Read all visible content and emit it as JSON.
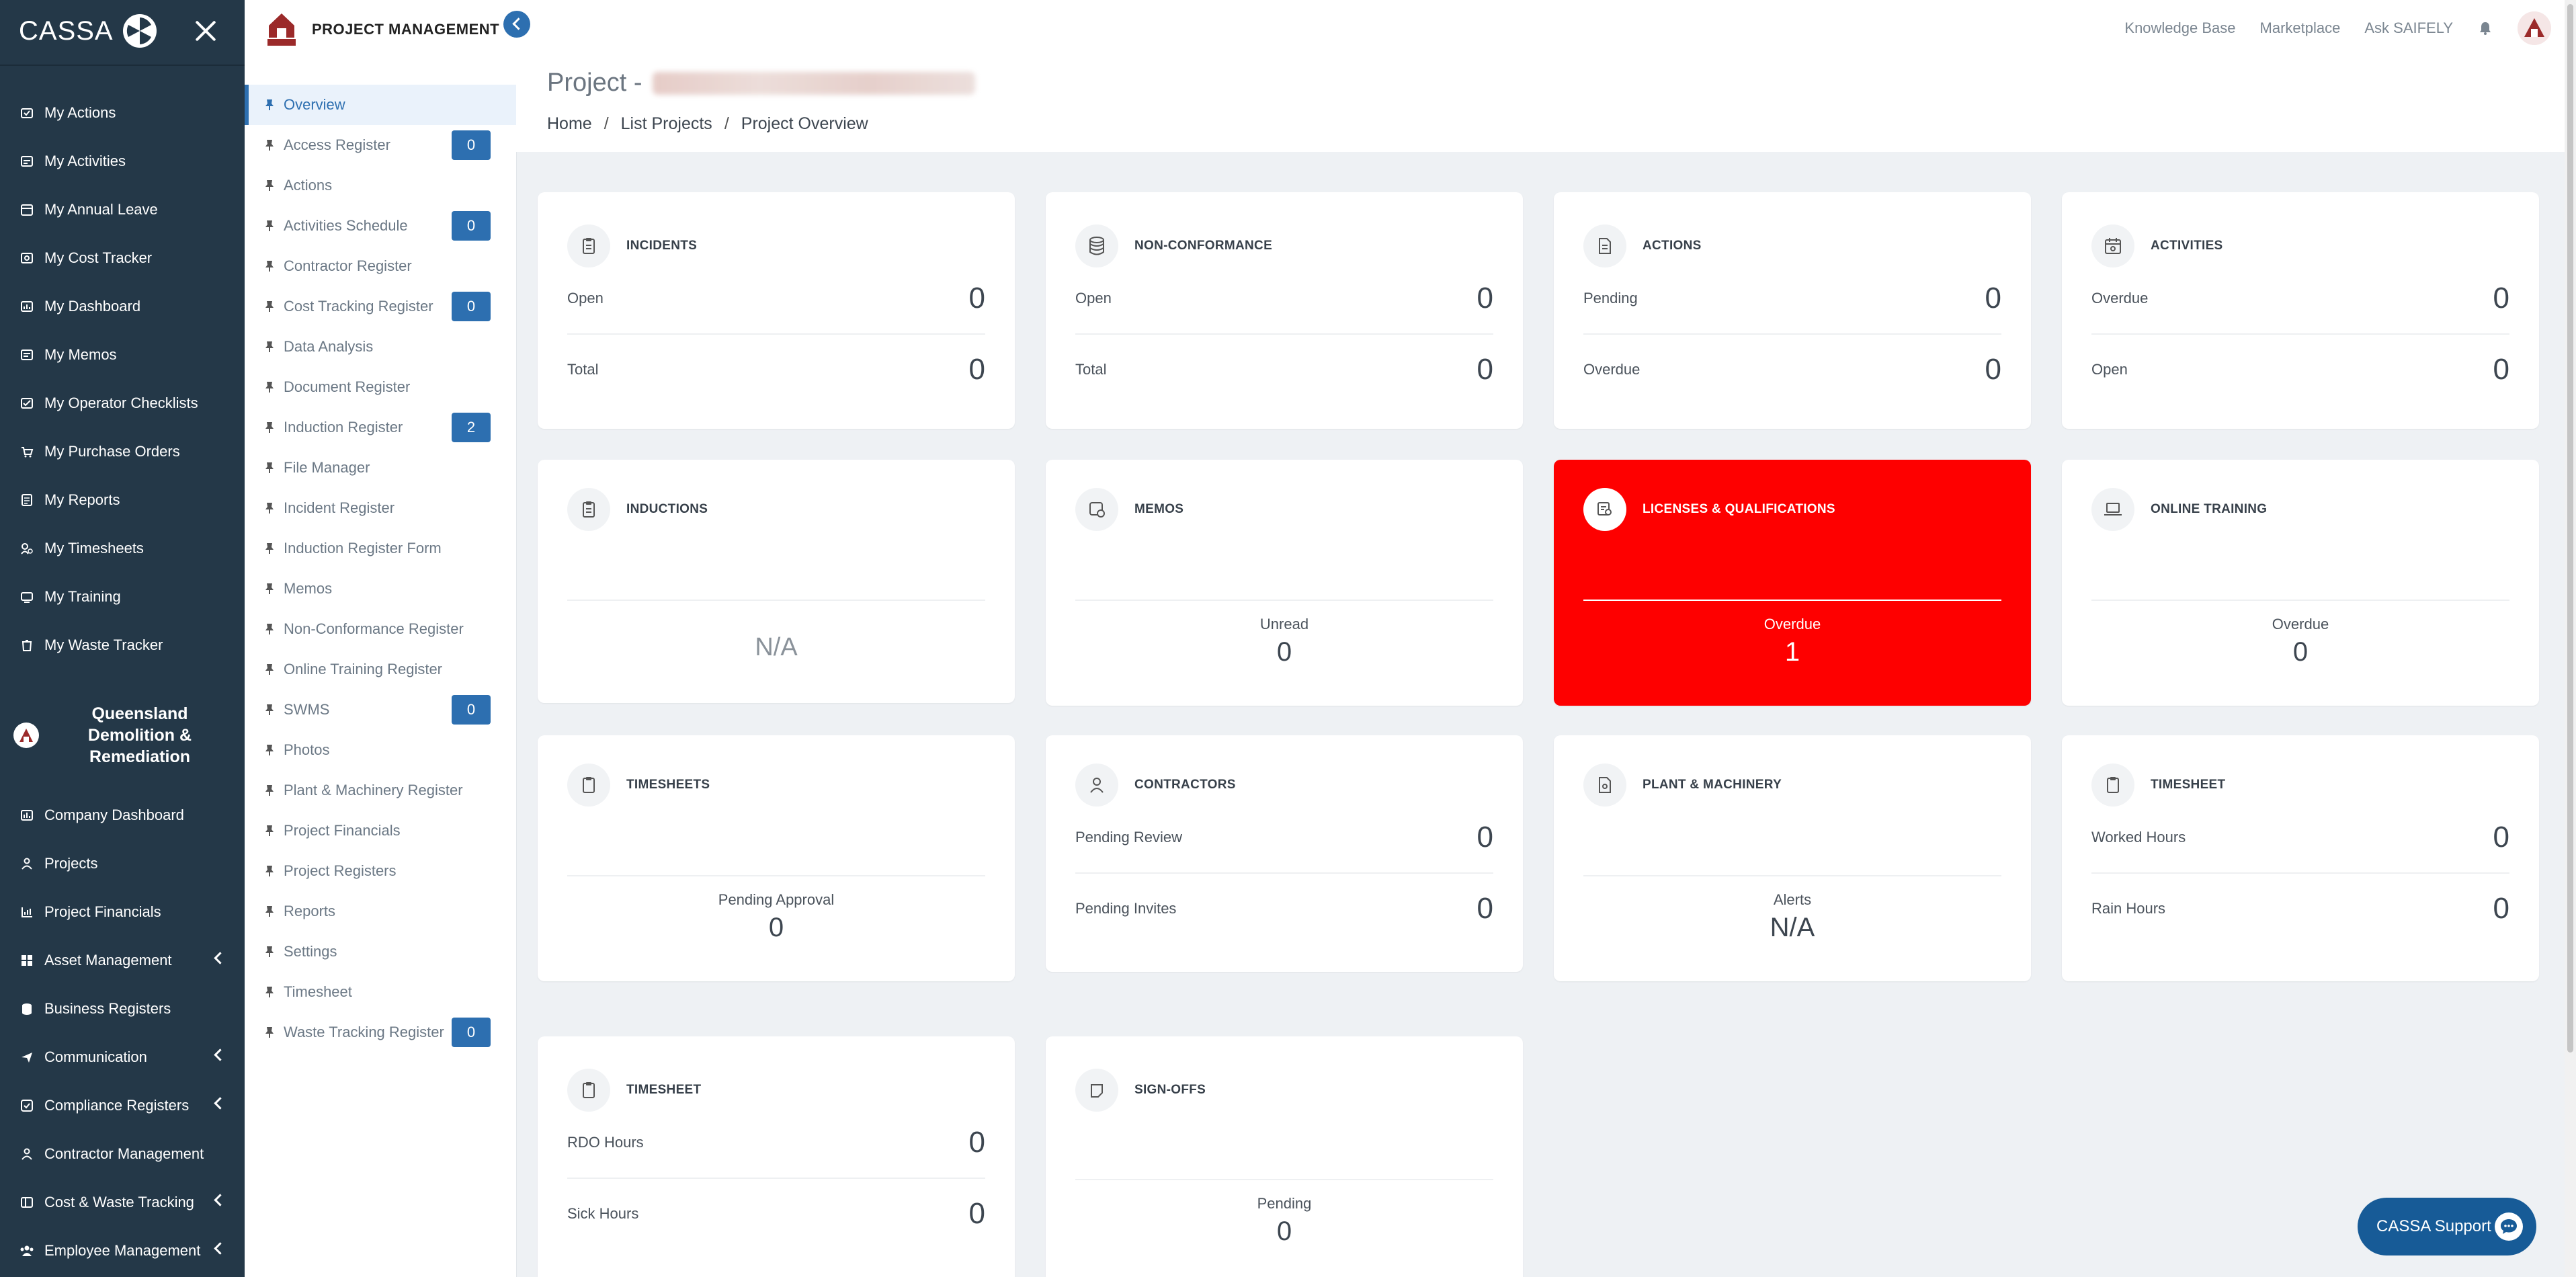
{
  "app": {
    "brand": "CASSA",
    "project_section_title": "PROJECT MANAGEMENT"
  },
  "sidebar": {
    "items": [
      {
        "label": "My Actions",
        "icon": "actions-icon"
      },
      {
        "label": "My Activities",
        "icon": "activities-icon"
      },
      {
        "label": "My Annual Leave",
        "icon": "leave-icon"
      },
      {
        "label": "My Cost Tracker",
        "icon": "cost-icon"
      },
      {
        "label": "My Dashboard",
        "icon": "dashboard-icon"
      },
      {
        "label": "My Memos",
        "icon": "memos-icon"
      },
      {
        "label": "My Operator Checklists",
        "icon": "checklist-icon"
      },
      {
        "label": "My Purchase Orders",
        "icon": "cart-icon"
      },
      {
        "label": "My Reports",
        "icon": "reports-icon"
      },
      {
        "label": "My Timesheets",
        "icon": "timesheets-icon"
      },
      {
        "label": "My Training",
        "icon": "training-icon"
      },
      {
        "label": "My Waste Tracker",
        "icon": "waste-icon"
      }
    ],
    "org_name": "Queensland Demolition & Remediation",
    "company_items": [
      {
        "label": "Company Dashboard",
        "icon": "company-dashboard-icon",
        "has_submenu": false
      },
      {
        "label": "Projects",
        "icon": "projects-icon",
        "has_submenu": false
      },
      {
        "label": "Project Financials",
        "icon": "financials-icon",
        "has_submenu": false
      },
      {
        "label": "Asset Management",
        "icon": "asset-icon",
        "has_submenu": true
      },
      {
        "label": "Business Registers",
        "icon": "registers-icon",
        "has_submenu": false
      },
      {
        "label": "Communication",
        "icon": "communication-icon",
        "has_submenu": true
      },
      {
        "label": "Compliance Registers",
        "icon": "compliance-icon",
        "has_submenu": true
      },
      {
        "label": "Contractor Management",
        "icon": "contractor-icon",
        "has_submenu": false
      },
      {
        "label": "Cost & Waste Tracking",
        "icon": "cost-waste-icon",
        "has_submenu": true
      },
      {
        "label": "Employee Management",
        "icon": "employee-icon",
        "has_submenu": true
      }
    ]
  },
  "project_nav": {
    "items": [
      {
        "label": "Overview",
        "active": true,
        "badge": null
      },
      {
        "label": "Access Register",
        "badge": "0"
      },
      {
        "label": "Actions",
        "badge": null
      },
      {
        "label": "Activities Schedule",
        "badge": "0"
      },
      {
        "label": "Contractor Register",
        "badge": null
      },
      {
        "label": "Cost Tracking Register",
        "badge": "0"
      },
      {
        "label": "Data Analysis",
        "badge": null
      },
      {
        "label": "Document Register",
        "badge": null
      },
      {
        "label": "Induction Register",
        "badge": "2"
      },
      {
        "label": "File Manager",
        "badge": null
      },
      {
        "label": "Incident Register",
        "badge": null
      },
      {
        "label": "Induction Register Form",
        "badge": null
      },
      {
        "label": "Memos",
        "badge": null
      },
      {
        "label": "Non-Conformance Register",
        "badge": null
      },
      {
        "label": "Online Training Register",
        "badge": null
      },
      {
        "label": "SWMS",
        "badge": "0"
      },
      {
        "label": "Photos",
        "badge": null
      },
      {
        "label": "Plant & Machinery Register",
        "badge": null
      },
      {
        "label": "Project Financials",
        "badge": null
      },
      {
        "label": "Project Registers",
        "badge": null
      },
      {
        "label": "Reports",
        "badge": null
      },
      {
        "label": "Settings",
        "badge": null
      },
      {
        "label": "Timesheet",
        "badge": null
      },
      {
        "label": "Waste Tracking Register",
        "badge": "0"
      }
    ]
  },
  "header": {
    "links": [
      "Knowledge Base",
      "Marketplace",
      "Ask SAIFELY"
    ]
  },
  "page": {
    "title_prefix": "Project -",
    "breadcrumb": [
      "Home",
      "List Projects",
      "Project Overview"
    ],
    "breadcrumb_sep": "/"
  },
  "cards": [
    {
      "id": "incidents",
      "title": "INCIDENTS",
      "icon": "clipboard-icon",
      "rows": [
        {
          "label": "Open",
          "value": "0"
        },
        {
          "label": "Total",
          "value": "0"
        }
      ]
    },
    {
      "id": "non-conformance",
      "title": "NON-CONFORMANCE",
      "icon": "database-icon",
      "rows": [
        {
          "label": "Open",
          "value": "0"
        },
        {
          "label": "Total",
          "value": "0"
        }
      ]
    },
    {
      "id": "actions",
      "title": "ACTIONS",
      "icon": "document-icon",
      "rows": [
        {
          "label": "Pending",
          "value": "0"
        },
        {
          "label": "Overdue",
          "value": "0"
        }
      ]
    },
    {
      "id": "activities",
      "title": "ACTIVITIES",
      "icon": "calendar-icon",
      "rows": [
        {
          "label": "Overdue",
          "value": "0"
        },
        {
          "label": "Open",
          "value": "0"
        }
      ]
    },
    {
      "id": "inductions",
      "title": "INDUCTIONS",
      "icon": "clipboard-icon",
      "center": {
        "label": "",
        "value": "N/A"
      }
    },
    {
      "id": "memos",
      "title": "MEMOS",
      "icon": "memo-icon",
      "center": {
        "label": "Unread",
        "value": "0"
      }
    },
    {
      "id": "licenses",
      "title": "LICENSES & QUALIFICATIONS",
      "icon": "certificate-icon",
      "alert": true,
      "center": {
        "label": "Overdue",
        "value": "1"
      }
    },
    {
      "id": "online-training",
      "title": "ONLINE TRAINING",
      "icon": "laptop-icon",
      "center": {
        "label": "Overdue",
        "value": "0"
      }
    },
    {
      "id": "timesheets",
      "title": "TIMESHEETS",
      "icon": "clipboard-icon",
      "center": {
        "label": "Pending Approval",
        "value": "0"
      }
    },
    {
      "id": "contractors",
      "title": "CONTRACTORS",
      "icon": "user-icon",
      "rows": [
        {
          "label": "Pending Review",
          "value": "0"
        },
        {
          "label": "Pending Invites",
          "value": "0"
        }
      ]
    },
    {
      "id": "plant-machinery",
      "title": "PLANT & MACHINERY",
      "icon": "document-icon",
      "center": {
        "label": "Alerts",
        "value": "N/A"
      }
    },
    {
      "id": "timesheet-hours",
      "title": "TIMESHEET",
      "icon": "clipboard-icon",
      "rows": [
        {
          "label": "Worked Hours",
          "value": "0"
        },
        {
          "label": "Rain Hours",
          "value": "0"
        }
      ]
    },
    {
      "id": "timesheet-leave",
      "title": "TIMESHEET",
      "icon": "clipboard-icon",
      "rows": [
        {
          "label": "RDO Hours",
          "value": "0"
        },
        {
          "label": "Sick Hours",
          "value": "0"
        }
      ]
    },
    {
      "id": "sign-offs",
      "title": "SIGN-OFFS",
      "icon": "signoff-icon",
      "center": {
        "label": "Pending",
        "value": "0"
      }
    }
  ],
  "support": {
    "label": "CASSA Support",
    "icon": "chat-icon"
  },
  "colors": {
    "sidebar_bg": "#243848",
    "accent": "#2d6fb0",
    "alert": "#fe0000",
    "page_bg": "#eef1f4"
  }
}
